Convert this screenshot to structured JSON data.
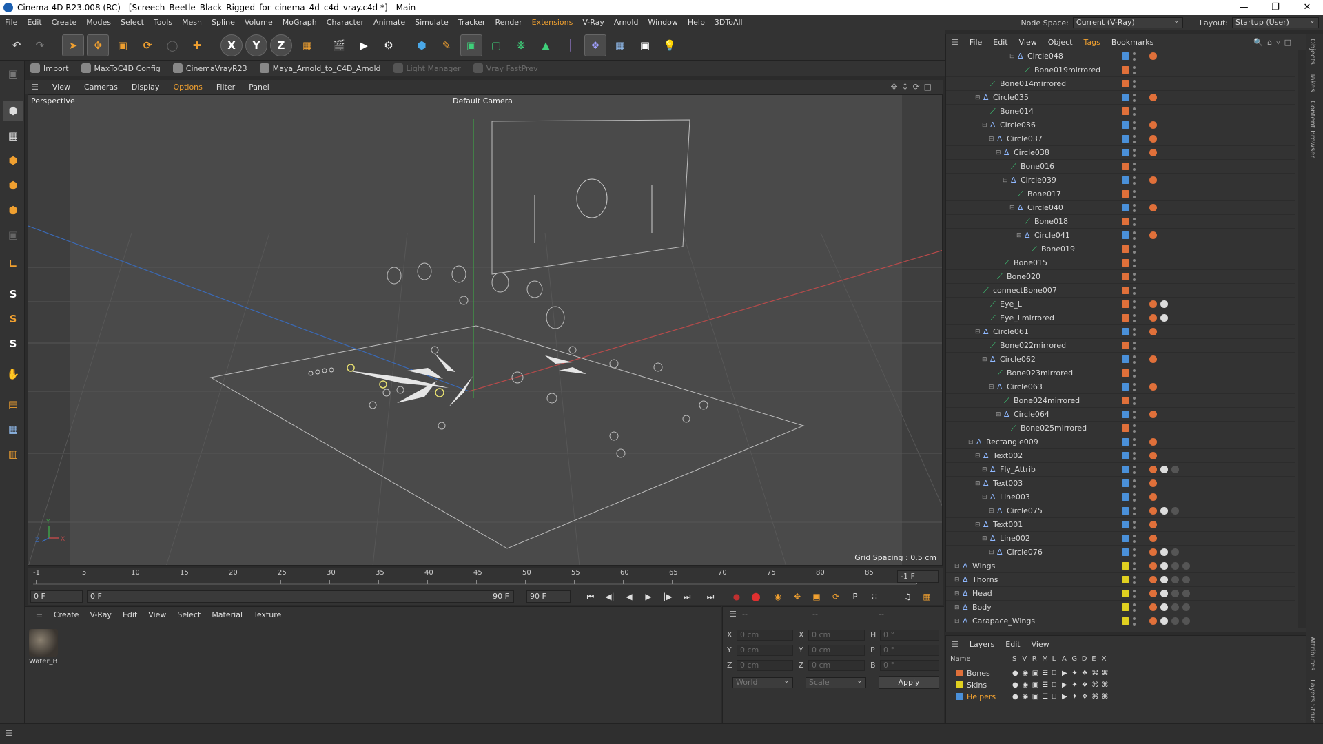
{
  "window": {
    "title": "Cinema 4D R23.008 (RC) - [Screech_Beetle_Black_Rigged_for_cinema_4d_c4d_vray.c4d *] - Main"
  },
  "menubar": {
    "items": [
      "File",
      "Edit",
      "Create",
      "Modes",
      "Select",
      "Tools",
      "Mesh",
      "Spline",
      "Volume",
      "MoGraph",
      "Character",
      "Animate",
      "Simulate",
      "Tracker",
      "Render",
      "Extensions",
      "V-Ray",
      "Arnold",
      "Window",
      "Help",
      "3DToAll"
    ],
    "node_space_label": "Node Space:",
    "node_space_value": "Current (V-Ray)",
    "layout_label": "Layout:",
    "layout_value": "Startup (User)"
  },
  "shelf": {
    "items": [
      "Import",
      "MaxToC4D Config",
      "CinemaVrayR23",
      "Maya_Arnold_to_C4D_Arnold",
      "Light Manager",
      "Vray FastPrev"
    ]
  },
  "viewport": {
    "menu": [
      "View",
      "Cameras",
      "Display",
      "Options",
      "Filter",
      "Panel"
    ],
    "label": "Perspective",
    "camera": "Default Camera",
    "grid_spacing": "Grid Spacing : 0.5 cm"
  },
  "timeline": {
    "ticks": [
      "-1",
      "5",
      "10",
      "15",
      "20",
      "25",
      "30",
      "35",
      "40",
      "45",
      "50",
      "55",
      "60",
      "65",
      "70",
      "75",
      "80",
      "85",
      "90"
    ],
    "current_frame_field": "-1 F"
  },
  "transport": {
    "start_field": "0 F",
    "range_start": "0 F",
    "range_end": "90 F",
    "end_field": "90 F"
  },
  "material_manager": {
    "menu": [
      "Create",
      "V-Ray",
      "Edit",
      "View",
      "Select",
      "Material",
      "Texture"
    ],
    "materials": [
      {
        "name": "Water_B"
      }
    ]
  },
  "attributes": {
    "header_dash": "--",
    "pos_labels": [
      "X",
      "Y",
      "Z"
    ],
    "pos_values": [
      "0 cm",
      "0 cm",
      "0 cm"
    ],
    "size_labels": [
      "X",
      "Y",
      "Z"
    ],
    "size_values": [
      "0 cm",
      "0 cm",
      "0 cm"
    ],
    "rot_labels": [
      "H",
      "P",
      "B"
    ],
    "rot_values": [
      "0 °",
      "0 °",
      "0 °"
    ],
    "coord_system": "World",
    "mode": "Scale",
    "apply_label": "Apply"
  },
  "object_manager": {
    "menu": [
      "File",
      "Edit",
      "View",
      "Object",
      "Tags",
      "Bookmarks"
    ],
    "rows": [
      {
        "name": "Circle048",
        "depth": 9,
        "type": "null",
        "color": "#4a90d9",
        "tags": 1
      },
      {
        "name": "Bone019mirrored",
        "depth": 10,
        "type": "bone",
        "color": "#e0703a",
        "tags": 0
      },
      {
        "name": "Bone014mirrored",
        "depth": 5,
        "type": "bone",
        "color": "#e0703a",
        "tags": 0
      },
      {
        "name": "Circle035",
        "depth": 4,
        "type": "null",
        "color": "#4a90d9",
        "tags": 1
      },
      {
        "name": "Bone014",
        "depth": 5,
        "type": "bone",
        "color": "#e0703a",
        "tags": 0
      },
      {
        "name": "Circle036",
        "depth": 5,
        "type": "null",
        "color": "#4a90d9",
        "tags": 1
      },
      {
        "name": "Circle037",
        "depth": 6,
        "type": "null",
        "color": "#4a90d9",
        "tags": 1
      },
      {
        "name": "Circle038",
        "depth": 7,
        "type": "null",
        "color": "#4a90d9",
        "tags": 1
      },
      {
        "name": "Bone016",
        "depth": 8,
        "type": "bone",
        "color": "#e0703a",
        "tags": 0
      },
      {
        "name": "Circle039",
        "depth": 8,
        "type": "null",
        "color": "#4a90d9",
        "tags": 1
      },
      {
        "name": "Bone017",
        "depth": 9,
        "type": "bone",
        "color": "#e0703a",
        "tags": 0
      },
      {
        "name": "Circle040",
        "depth": 9,
        "type": "null",
        "color": "#4a90d9",
        "tags": 1
      },
      {
        "name": "Bone018",
        "depth": 10,
        "type": "bone",
        "color": "#e0703a",
        "tags": 0
      },
      {
        "name": "Circle041",
        "depth": 10,
        "type": "null",
        "color": "#4a90d9",
        "tags": 1
      },
      {
        "name": "Bone019",
        "depth": 11,
        "type": "bone",
        "color": "#e0703a",
        "tags": 0
      },
      {
        "name": "Bone015",
        "depth": 7,
        "type": "bone",
        "color": "#e0703a",
        "tags": 0
      },
      {
        "name": "Bone020",
        "depth": 6,
        "type": "bone",
        "color": "#e0703a",
        "tags": 0
      },
      {
        "name": "connectBone007",
        "depth": 4,
        "type": "bone",
        "color": "#e0703a",
        "tags": 0
      },
      {
        "name": "Eye_L",
        "depth": 5,
        "type": "bone",
        "color": "#e0703a",
        "tags": 2
      },
      {
        "name": "Eye_Lmirrored",
        "depth": 5,
        "type": "bone",
        "color": "#e0703a",
        "tags": 2
      },
      {
        "name": "Circle061",
        "depth": 4,
        "type": "null",
        "color": "#4a90d9",
        "tags": 1
      },
      {
        "name": "Bone022mirrored",
        "depth": 5,
        "type": "bone",
        "color": "#e0703a",
        "tags": 0
      },
      {
        "name": "Circle062",
        "depth": 5,
        "type": "null",
        "color": "#4a90d9",
        "tags": 1
      },
      {
        "name": "Bone023mirrored",
        "depth": 6,
        "type": "bone",
        "color": "#e0703a",
        "tags": 0
      },
      {
        "name": "Circle063",
        "depth": 6,
        "type": "null",
        "color": "#4a90d9",
        "tags": 1
      },
      {
        "name": "Bone024mirrored",
        "depth": 7,
        "type": "bone",
        "color": "#e0703a",
        "tags": 0
      },
      {
        "name": "Circle064",
        "depth": 7,
        "type": "null",
        "color": "#4a90d9",
        "tags": 1
      },
      {
        "name": "Bone025mirrored",
        "depth": 8,
        "type": "bone",
        "color": "#e0703a",
        "tags": 0
      },
      {
        "name": "Rectangle009",
        "depth": 3,
        "type": "null",
        "color": "#4a90d9",
        "tags": 1
      },
      {
        "name": "Text002",
        "depth": 4,
        "type": "null",
        "color": "#4a90d9",
        "tags": 1
      },
      {
        "name": "Fly_Attrib",
        "depth": 5,
        "type": "null",
        "color": "#4a90d9",
        "tags": 3
      },
      {
        "name": "Text003",
        "depth": 4,
        "type": "null",
        "color": "#4a90d9",
        "tags": 1
      },
      {
        "name": "Line003",
        "depth": 5,
        "type": "null",
        "color": "#4a90d9",
        "tags": 1
      },
      {
        "name": "Circle075",
        "depth": 6,
        "type": "null",
        "color": "#4a90d9",
        "tags": 3
      },
      {
        "name": "Text001",
        "depth": 4,
        "type": "null",
        "color": "#4a90d9",
        "tags": 1
      },
      {
        "name": "Line002",
        "depth": 5,
        "type": "null",
        "color": "#4a90d9",
        "tags": 1
      },
      {
        "name": "Circle076",
        "depth": 6,
        "type": "null",
        "color": "#4a90d9",
        "tags": 3
      },
      {
        "name": "Wings",
        "depth": 1,
        "type": "null",
        "color": "#e0d020",
        "tags": 4
      },
      {
        "name": "Thorns",
        "depth": 1,
        "type": "null",
        "color": "#e0d020",
        "tags": 4
      },
      {
        "name": "Head",
        "depth": 1,
        "type": "null",
        "color": "#e0d020",
        "tags": 4
      },
      {
        "name": "Body",
        "depth": 1,
        "type": "null",
        "color": "#e0d020",
        "tags": 4
      },
      {
        "name": "Carapace_Wings",
        "depth": 1,
        "type": "null",
        "color": "#e0d020",
        "tags": 4
      }
    ]
  },
  "layers": {
    "menu": [
      "Layers",
      "Edit",
      "View"
    ],
    "columns": [
      "Name",
      "S",
      "V",
      "R",
      "M",
      "L",
      "A",
      "G",
      "D",
      "E",
      "X"
    ],
    "items": [
      {
        "name": "Bones",
        "color": "#e0703a",
        "text_color": "#d8d8d8"
      },
      {
        "name": "Skins",
        "color": "#e0d020",
        "text_color": "#d8d8d8"
      },
      {
        "name": "Helpers",
        "color": "#4a90d9",
        "text_color": "#f0a030"
      }
    ]
  },
  "side_tabs": [
    "Objects",
    "Takes",
    "Content Browser",
    "Attributes",
    "Layers",
    "Struct"
  ]
}
